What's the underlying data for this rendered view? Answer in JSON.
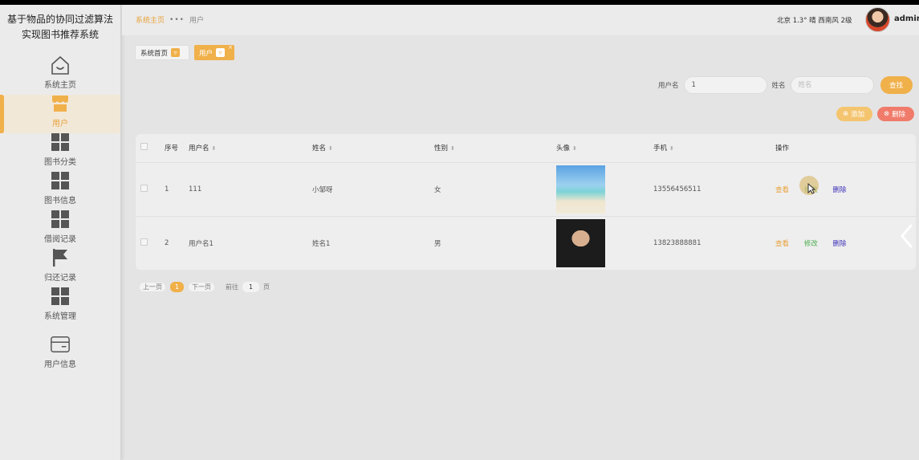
{
  "app": {
    "title_line1": "基于物品的协同过滤算法",
    "title_line2": "实现图书推荐系统"
  },
  "sidebar": {
    "items": [
      {
        "label": "系统主页",
        "icon": "home-icon"
      },
      {
        "label": "用户",
        "icon": "store-icon"
      },
      {
        "label": "图书分类",
        "icon": "grid-icon"
      },
      {
        "label": "图书信息",
        "icon": "grid-icon"
      },
      {
        "label": "借阅记录",
        "icon": "grid-icon"
      },
      {
        "label": "归还记录",
        "icon": "flag-icon"
      },
      {
        "label": "系统管理",
        "icon": "grid-icon"
      },
      {
        "label": "用户信息",
        "icon": "card-icon"
      }
    ],
    "active_index": 1
  },
  "header": {
    "breadcrumb_home": "系统主页",
    "breadcrumb_sep": "•••",
    "breadcrumb_current": "用户",
    "weather": "北京 1.3° 晴 西南风 2级",
    "username": "admin"
  },
  "tags": {
    "home_label": "系统首页",
    "current_label": "用户"
  },
  "search": {
    "username_label": "用户名",
    "username_value": "1",
    "name_label": "姓名",
    "name_placeholder": "姓名",
    "search_button": "查找"
  },
  "actions": {
    "add_label": "添加",
    "delete_label": "删除"
  },
  "table": {
    "headers": {
      "index": "序号",
      "username": "用户名",
      "name": "姓名",
      "gender": "性别",
      "avatar": "头像",
      "phone": "手机",
      "operation": "操作"
    },
    "rows": [
      {
        "index": "1",
        "username": "111",
        "name": "小邹呀",
        "gender": "女",
        "phone": "13556456511",
        "avatar": "beach-photo"
      },
      {
        "index": "2",
        "username": "用户名1",
        "name": "姓名1",
        "gender": "男",
        "phone": "13823888881",
        "avatar": "person-photo"
      }
    ],
    "ops": {
      "view": "查看",
      "edit": "修改",
      "delete": "删除"
    }
  },
  "pager": {
    "prev": "上一页",
    "current_page": "1",
    "next": "下一页",
    "goto_prefix": "前往",
    "goto_value": "1",
    "goto_suffix": "页"
  },
  "colors": {
    "accent": "#f0b04a",
    "danger": "#f07b6a",
    "edit": "#4caf50",
    "delete_link": "#3b2fb7"
  }
}
